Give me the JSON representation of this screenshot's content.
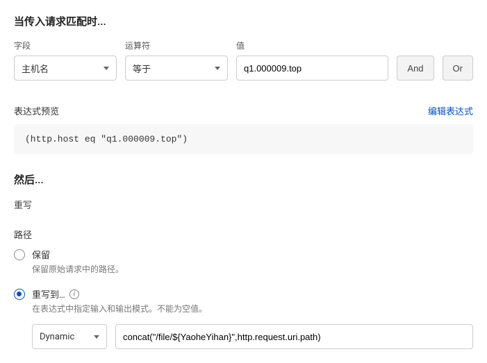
{
  "match": {
    "title": "当传入请求匹配时...",
    "field_label": "字段",
    "field_value": "主机名",
    "op_label": "运算符",
    "op_value": "等于",
    "value_label": "值",
    "value_value": "q1.000009.top",
    "and_label": "And",
    "or_label": "Or"
  },
  "preview": {
    "label": "表达式预览",
    "edit_link": "编辑表达式",
    "code": "(http.host eq \"q1.000009.top\")"
  },
  "then": {
    "title": "然后...",
    "action": "重写"
  },
  "path": {
    "label": "路径",
    "options": [
      {
        "title": "保留",
        "desc": "保留原始请求中的路径。"
      },
      {
        "title": "重写到…",
        "desc": "在表达式中指定输入和输出模式。不能为空值。"
      }
    ],
    "type_value": "Dynamic",
    "expr_value": "concat(\"/file/${YaoheYihan}\",http.request.uri.path)"
  }
}
